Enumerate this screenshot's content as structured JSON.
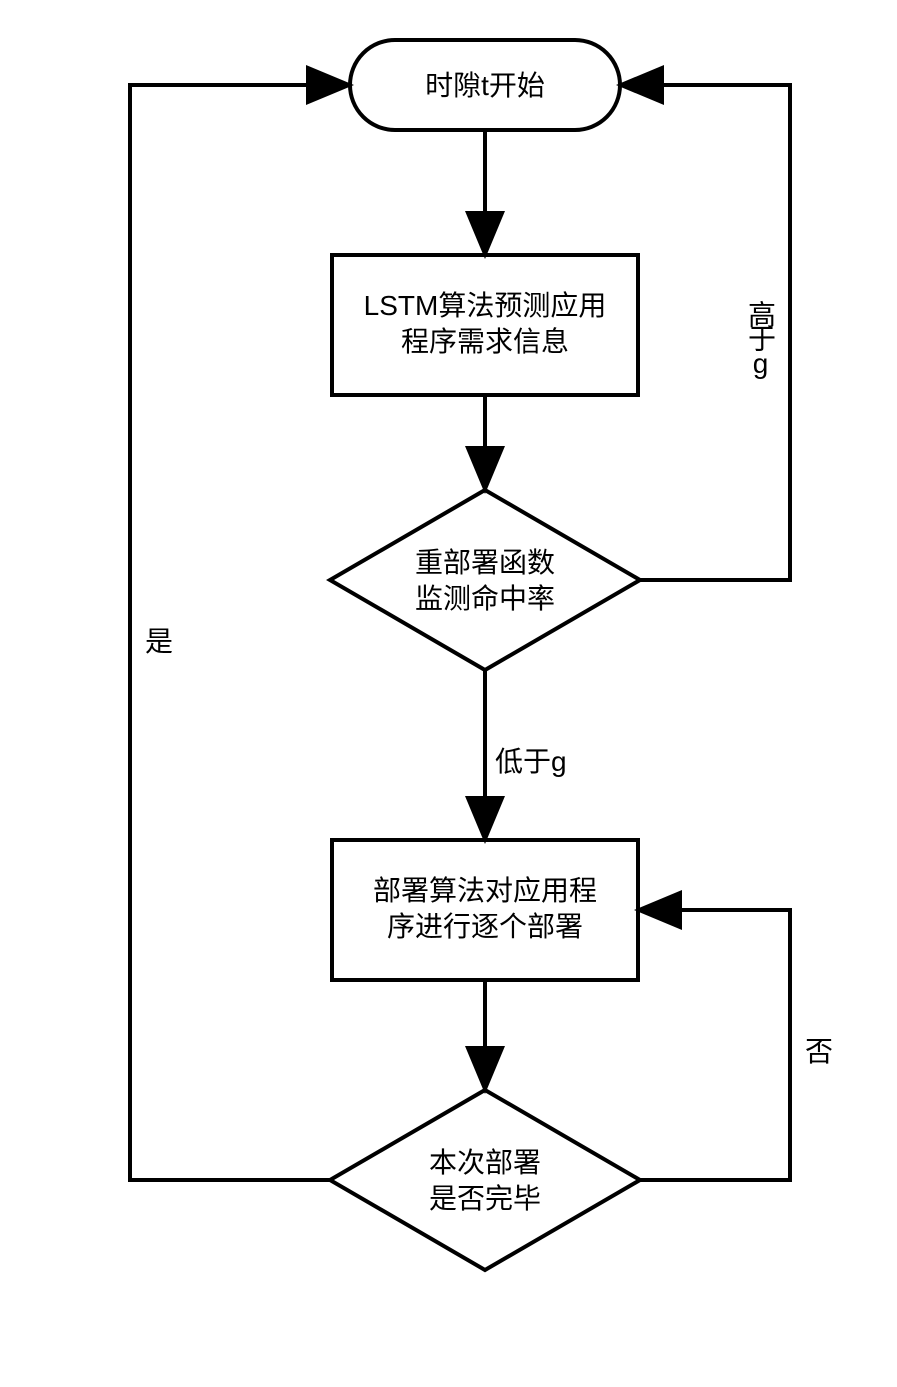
{
  "flowchart": {
    "start": "时隙t开始",
    "process1_line1": "LSTM算法预测应用",
    "process1_line2": "程序需求信息",
    "decision1_line1": "重部署函数",
    "decision1_line2": "监测命中率",
    "process2_line1": "部署算法对应用程",
    "process2_line2": "序进行逐个部署",
    "decision2_line1": "本次部署",
    "decision2_line2": "是否完毕"
  },
  "labels": {
    "higher": "高于g",
    "lower": "低于g",
    "yes": "是",
    "no": "否"
  }
}
